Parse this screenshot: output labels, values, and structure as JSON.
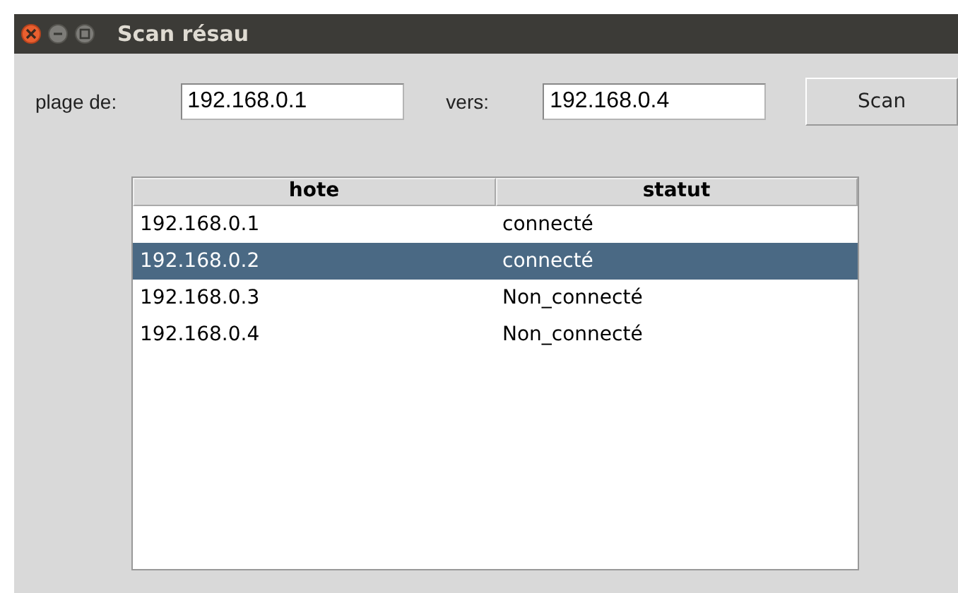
{
  "window": {
    "title": "Scan résau"
  },
  "form": {
    "from_label": "plage de:",
    "from_value": "192.168.0.1",
    "to_label": "vers:",
    "to_value": "192.168.0.4",
    "button": "Scan"
  },
  "table": {
    "columns": [
      "hote",
      "statut"
    ],
    "rows": [
      {
        "cells": [
          "192.168.0.1",
          "connecté"
        ],
        "selected": false
      },
      {
        "cells": [
          "192.168.0.2",
          "connecté"
        ],
        "selected": true
      },
      {
        "cells": [
          "192.168.0.3",
          "Non_connecté"
        ],
        "selected": false
      },
      {
        "cells": [
          "192.168.0.4",
          "Non_connecté"
        ],
        "selected": false
      }
    ]
  }
}
